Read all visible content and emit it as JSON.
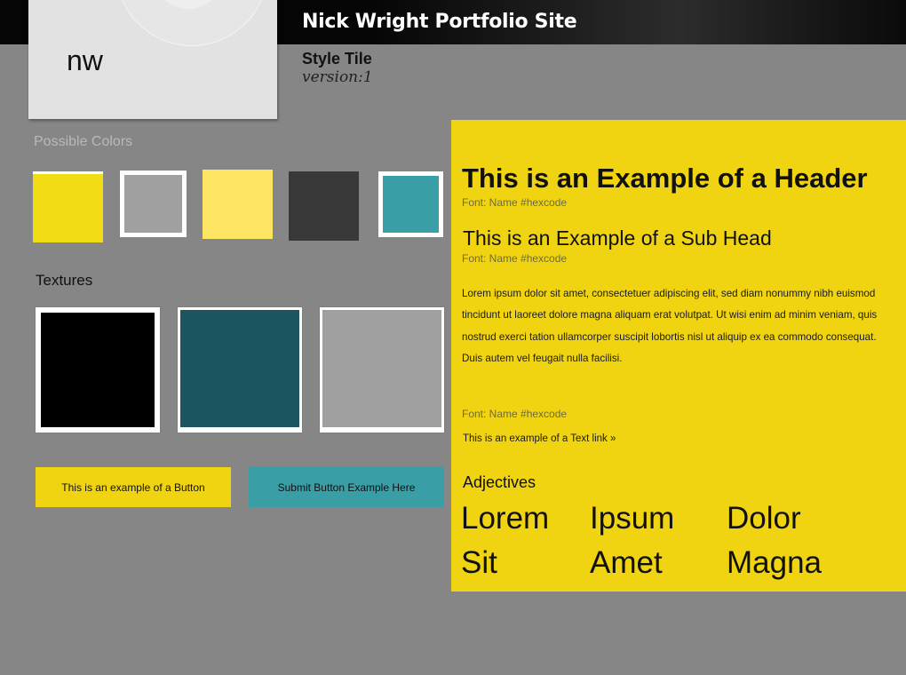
{
  "header": {
    "site_title": "Nick Wright Portfolio Site"
  },
  "logo": {
    "text": "nw"
  },
  "tile": {
    "title": "Style Tile",
    "version": "version:1"
  },
  "colors": {
    "label": "Possible Colors",
    "swatches": [
      "#f2dc13",
      "#a0a0a0",
      "#fde664",
      "#383838",
      "#3a9ea6"
    ]
  },
  "textures": {
    "label": "Textures",
    "items": [
      "#000000",
      "#1b5660",
      "#a0a0a0"
    ]
  },
  "buttons": {
    "primary_label": "This is an example of a Button",
    "primary_color": "#f0d412",
    "submit_label": "Submit Button Example Here",
    "submit_color": "#3a9ea6"
  },
  "typography": {
    "panel_color": "#f0d412",
    "header": "This is an Example of a Header",
    "header_font_note": "Font: Name #hexcode",
    "subhead": "This is an Example of a Sub Head",
    "subhead_font_note": "Font: Name #hexcode",
    "body": "Lorem ipsum dolor sit amet, consectetuer adipiscing elit, sed diam nonummy nibh euismod tincidunt ut laoreet dolore magna aliquam erat volutpat. Ut wisi enim ad minim veniam, quis nostrud exerci tation ullamcorper suscipit lobortis nisl ut aliquip ex ea commodo consequat. Duis autem vel feugait nulla facilisi.",
    "link_font_note": "Font: Name #hexcode",
    "text_link": "This is an example of a Text link »"
  },
  "adjectives": {
    "label": "Adjectives",
    "words": [
      "Lorem",
      "Ipsum",
      "Dolor",
      "Sit",
      "Amet",
      "Magna"
    ]
  }
}
